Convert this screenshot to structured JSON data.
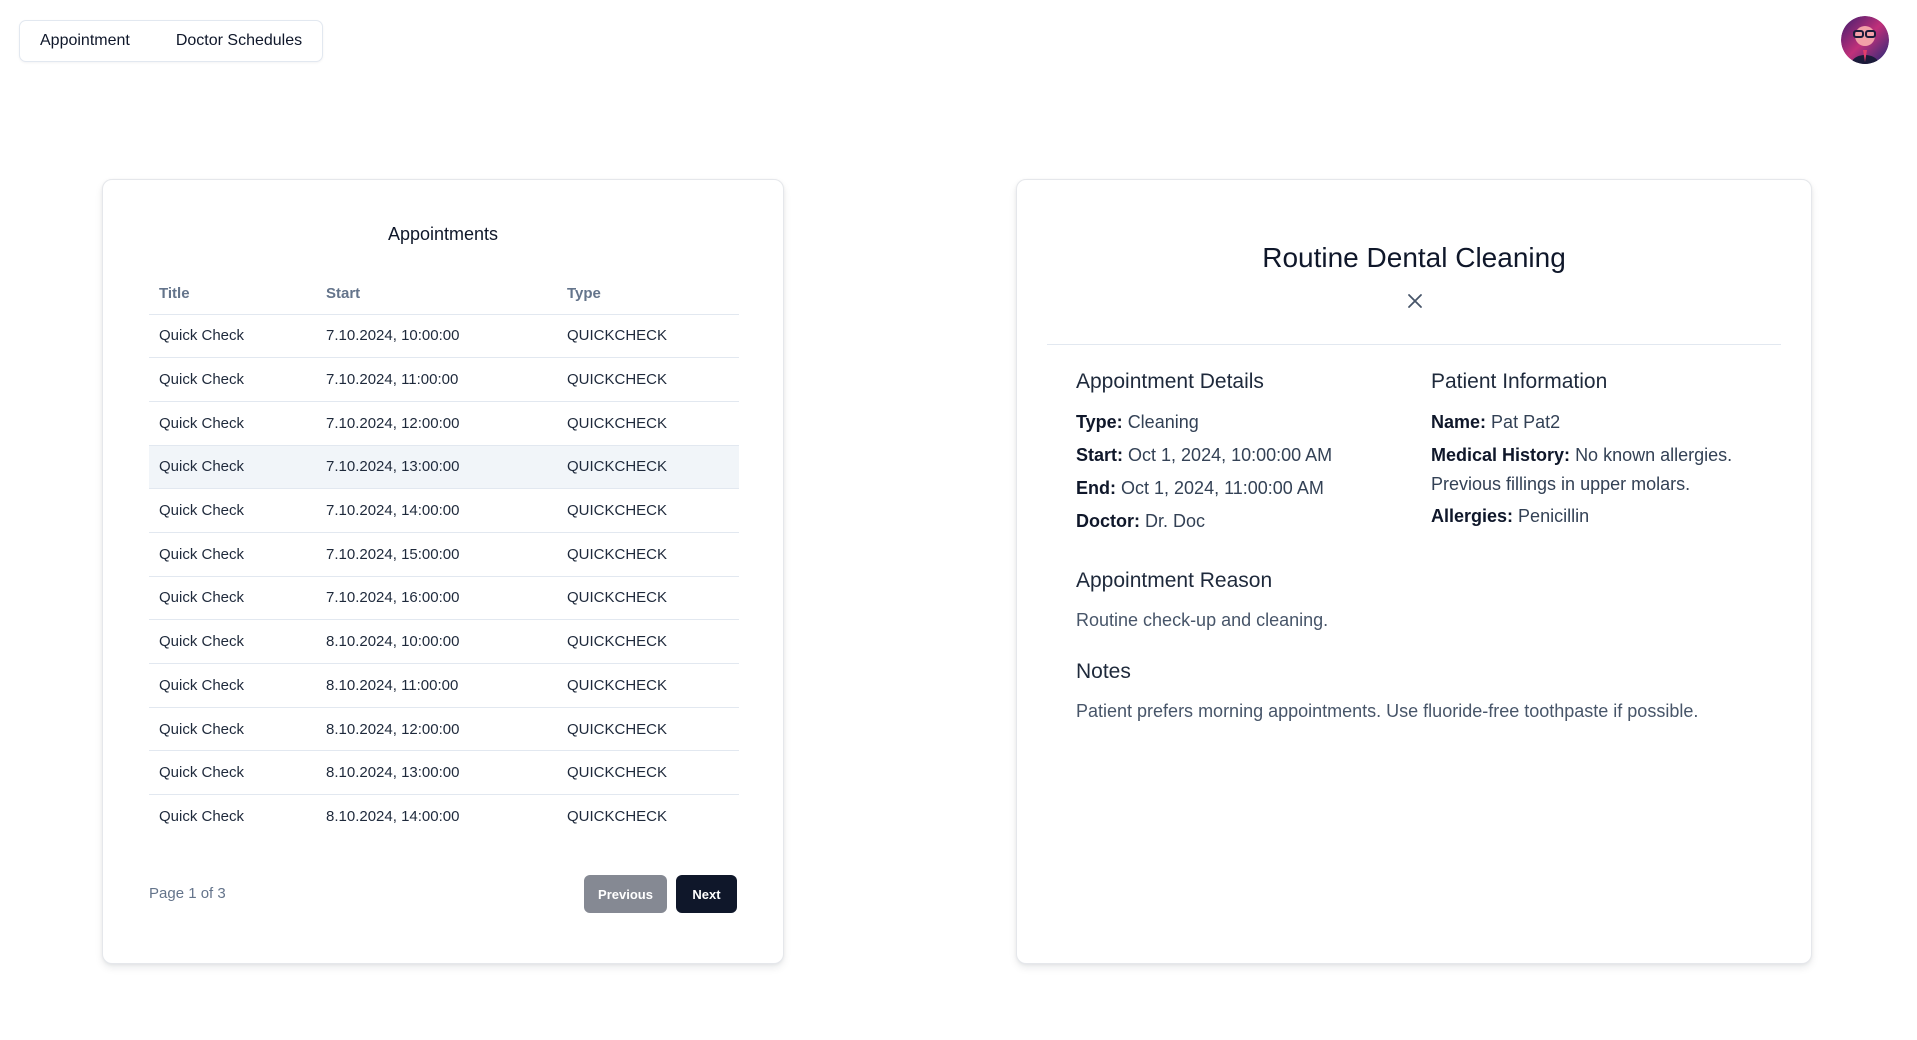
{
  "nav": {
    "items": [
      {
        "label": "Appointment"
      },
      {
        "label": "Doctor Schedules"
      }
    ]
  },
  "appointments": {
    "title": "Appointments",
    "columns": [
      "Title",
      "Start",
      "Type"
    ],
    "rows": [
      {
        "title": "Quick Check",
        "start": "7.10.2024, 10:00:00",
        "type": "QUICKCHECK"
      },
      {
        "title": "Quick Check",
        "start": "7.10.2024, 11:00:00",
        "type": "QUICKCHECK"
      },
      {
        "title": "Quick Check",
        "start": "7.10.2024, 12:00:00",
        "type": "QUICKCHECK"
      },
      {
        "title": "Quick Check",
        "start": "7.10.2024, 13:00:00",
        "type": "QUICKCHECK"
      },
      {
        "title": "Quick Check",
        "start": "7.10.2024, 14:00:00",
        "type": "QUICKCHECK"
      },
      {
        "title": "Quick Check",
        "start": "7.10.2024, 15:00:00",
        "type": "QUICKCHECK"
      },
      {
        "title": "Quick Check",
        "start": "7.10.2024, 16:00:00",
        "type": "QUICKCHECK"
      },
      {
        "title": "Quick Check",
        "start": "8.10.2024, 10:00:00",
        "type": "QUICKCHECK"
      },
      {
        "title": "Quick Check",
        "start": "8.10.2024, 11:00:00",
        "type": "QUICKCHECK"
      },
      {
        "title": "Quick Check",
        "start": "8.10.2024, 12:00:00",
        "type": "QUICKCHECK"
      },
      {
        "title": "Quick Check",
        "start": "8.10.2024, 13:00:00",
        "type": "QUICKCHECK"
      },
      {
        "title": "Quick Check",
        "start": "8.10.2024, 14:00:00",
        "type": "QUICKCHECK"
      }
    ],
    "page_info": "Page 1 of 3",
    "prev_label": "Previous",
    "next_label": "Next"
  },
  "detail": {
    "title": "Routine Dental Cleaning",
    "close_icon": "close-icon",
    "appointment_details": {
      "heading": "Appointment Details",
      "type_label": "Type:",
      "type_value": "Cleaning",
      "start_label": "Start:",
      "start_value": "Oct 1, 2024, 10:00:00 AM",
      "end_label": "End:",
      "end_value": "Oct 1, 2024, 11:00:00 AM",
      "doctor_label": "Doctor:",
      "doctor_value": "Dr. Doc"
    },
    "patient_information": {
      "heading": "Patient Information",
      "name_label": "Name:",
      "name_value": "Pat Pat2",
      "history_label": "Medical History:",
      "history_value": "No known allergies. Previous fillings in upper molars.",
      "allergies_label": "Allergies:",
      "allergies_value": "Penicillin"
    },
    "reason": {
      "heading": "Appointment Reason",
      "text": "Routine check-up and cleaning."
    },
    "notes": {
      "heading": "Notes",
      "text": "Patient prefers morning appointments. Use fluoride-free toothpaste if possible."
    }
  },
  "colors": {
    "primary": "#0f172a",
    "muted_button": "#858993",
    "row_hover": "#f1f5f9",
    "border": "#e2e8f0"
  }
}
